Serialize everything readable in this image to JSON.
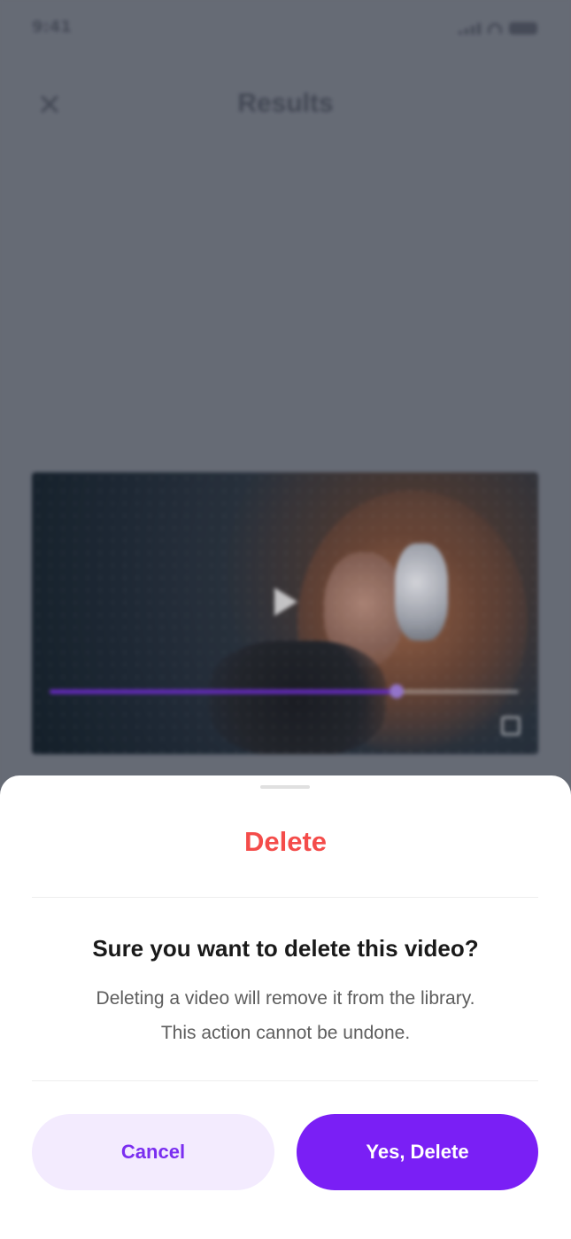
{
  "status_bar": {
    "time": "9:41"
  },
  "header": {
    "title": "Results",
    "close_icon": "close-icon"
  },
  "video": {
    "progress_fraction": 0.74,
    "accent_color": "#6a2cc7"
  },
  "sheet": {
    "title": "Delete",
    "title_color": "#f44c4a",
    "question": "Sure you want to delete this video?",
    "description_line1": "Deleting a video will remove it from the library.",
    "description_line2": "This action cannot be undone.",
    "cancel_label": "Cancel",
    "confirm_label": "Yes, Delete",
    "primary_color": "#7a1ff5",
    "secondary_bg": "#f3ebfe"
  }
}
